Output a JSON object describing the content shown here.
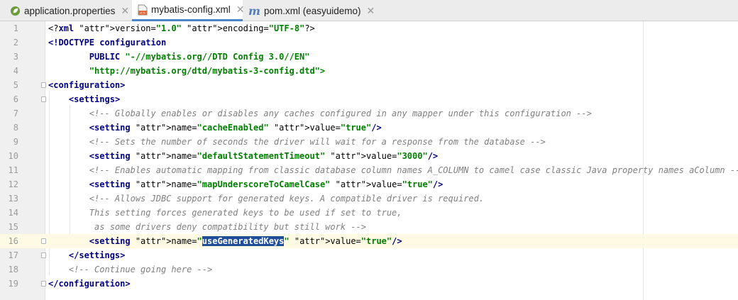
{
  "tabs": [
    {
      "label": "application.properties",
      "icon": "spring-leaf-icon",
      "active": false
    },
    {
      "label": "mybatis-config.xml",
      "icon": "xml-file-icon",
      "active": true
    },
    {
      "label": "pom.xml (easyuidemo)",
      "icon": "maven-icon",
      "active": false
    }
  ],
  "colors": {
    "active_tab_underline": "#4a86c8",
    "current_line": "#fffae3",
    "selection": "#1f4e9a"
  },
  "editor": {
    "current_line": 16,
    "selected_text": "useGeneratedKeys",
    "line_numbers": [
      "1",
      "2",
      "3",
      "4",
      "5",
      "6",
      "7",
      "8",
      "9",
      "10",
      "11",
      "12",
      "13",
      "14",
      "15",
      "16",
      "17",
      "18",
      "19"
    ],
    "lines": [
      "<?xml version=\"1.0\" encoding=\"UTF-8\"?>",
      "<!DOCTYPE configuration",
      "        PUBLIC \"-//mybatis.org//DTD Config 3.0//EN\"",
      "        \"http://mybatis.org/dtd/mybatis-3-config.dtd\">",
      "<configuration>",
      "    <settings>",
      "        <!-- Globally enables or disables any caches configured in any mapper under this configuration -->",
      "        <setting name=\"cacheEnabled\" value=\"true\"/>",
      "        <!-- Sets the number of seconds the driver will wait for a response from the database -->",
      "        <setting name=\"defaultStatementTimeout\" value=\"3000\"/>",
      "        <!-- Enables automatic mapping from classic database column names A_COLUMN to camel case classic Java property names aColumn -->",
      "        <setting name=\"mapUnderscoreToCamelCase\" value=\"true\"/>",
      "        <!-- Allows JDBC support for generated keys. A compatible driver is required.",
      "        This setting forces generated keys to be used if set to true,",
      "         as some drivers deny compatibility but still work -->",
      "        <setting name=\"useGeneratedKeys\" value=\"true\"/>",
      "    </settings>",
      "    <!-- Continue going here -->",
      "</configuration>"
    ]
  }
}
